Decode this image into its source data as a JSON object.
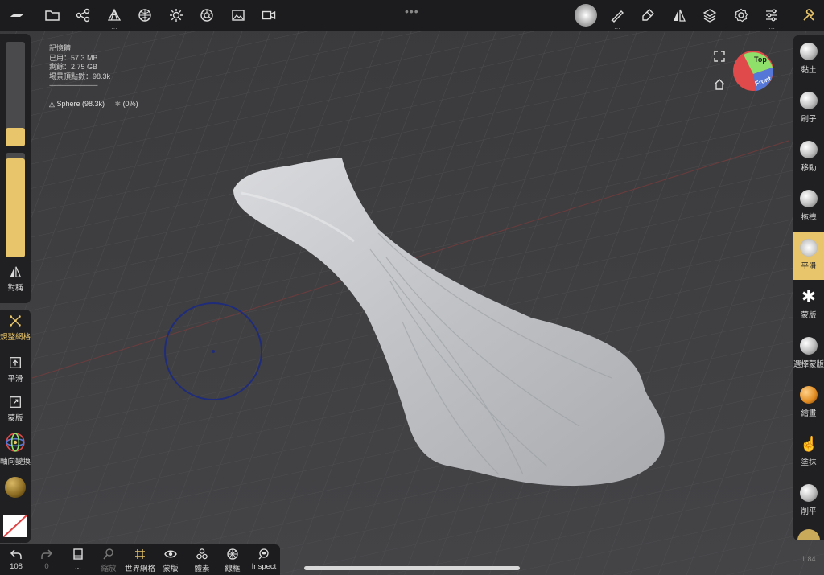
{
  "toolbar": {
    "icons": [
      "menu-logo-icon",
      "folder-icon",
      "scene-graph-icon",
      "topology-icon",
      "sphere-mesh-icon",
      "lighting-icon",
      "material-icon",
      "image-icon",
      "video-icon",
      "more-dots-icon",
      "brush-preview-icon",
      "stroke-icon",
      "picker-icon",
      "symmetry-icon",
      "layers-icon",
      "settings-icon",
      "sliders-icon",
      "tools-icon"
    ]
  },
  "info": {
    "memory_title": "記憶體",
    "used": "已用：57.3 MB",
    "free": "剩餘：2.75 GB",
    "vertices": "場景頂點數：98.3k",
    "separator": "------------------------------",
    "mesh_name": "Sphere (98.3k)",
    "mask_percent": "(0%)"
  },
  "left": {
    "symmetry": "對稱",
    "retopo": "規整網格",
    "smooth": "平滑",
    "mask": "蒙版",
    "gizmo": "軸向變換",
    "radius_fill": 0.18,
    "intensity_fill": 0.95
  },
  "right": {
    "tools": [
      "黏土",
      "刷子",
      "移動",
      "拖拽",
      "平滑",
      "蒙版",
      "選擇蒙版",
      "繪畫",
      "塗抹",
      "削平"
    ],
    "selected_index": 4
  },
  "bottom": {
    "undo_label": "108",
    "redo_label": "0",
    "unknown_label": "...",
    "zoom_label": "縮放",
    "grid_label": "世界網格",
    "mask_label": "蒙版",
    "voxel_label": "體素",
    "wire_label": "線框",
    "inspect_label": "Inspect"
  },
  "nav": {
    "top": "Top",
    "front": "Front"
  },
  "version": "1.84",
  "colors": {
    "accent": "#e8c56b",
    "background": "#3d3d3f",
    "panel": "#202022"
  }
}
